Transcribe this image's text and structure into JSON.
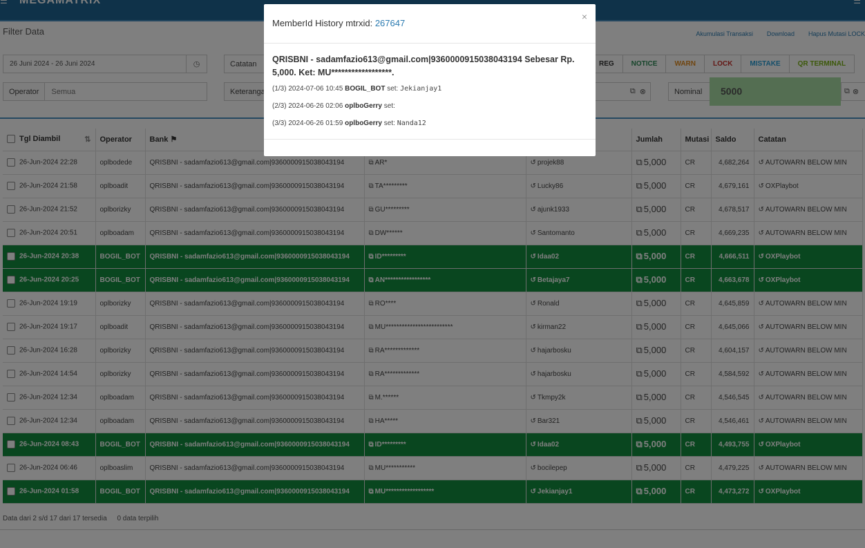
{
  "header": {
    "brand": "MEGAMATRIX"
  },
  "filter": {
    "title": "Filter Data",
    "links": [
      "Akumulasi Transaksi",
      "Download",
      "Hapus Mutasi LOCK"
    ],
    "date_range": "26 Juni 2024 - 26 Juni 2024",
    "catatan_label": "Catatan",
    "operator_label": "Operator",
    "operator_placeholder": "Semua",
    "keterangan_label": "Keterangan",
    "nominal_label": "Nominal",
    "nominal_value": "5000",
    "tags": [
      {
        "label": "REG",
        "color": "#555555"
      },
      {
        "label": "NOTICE",
        "color": "#2e8b57"
      },
      {
        "label": "WARN",
        "color": "#e08a1e"
      },
      {
        "label": "LOCK",
        "color": "#c9302c"
      },
      {
        "label": "MISTAKE",
        "color": "#2a9fd6"
      },
      {
        "label": "QR TERMINAL",
        "color": "#7ab317"
      }
    ]
  },
  "table": {
    "columns": [
      "Tgl Diambil",
      "Operator",
      "Bank",
      "",
      "",
      "Jumlah",
      "Mutasi",
      "Saldo",
      "Catatan"
    ],
    "rows": [
      {
        "tgl": "26-Jun-2024 22:28",
        "operator": "oplbodede",
        "bank": "QRISBNI - sadamfazio613@gmail.com|9360000915038043194",
        "ket": "AR*",
        "member": "projek88",
        "jumlah": "5,000",
        "mutasi": "CR",
        "saldo": "4,682,264",
        "catatan": "AUTOWARN BELOW MIN",
        "hl": false
      },
      {
        "tgl": "26-Jun-2024 21:58",
        "operator": "oplboadit",
        "bank": "QRISBNI - sadamfazio613@gmail.com|9360000915038043194",
        "ket": "TA*********",
        "member": "Lucky86",
        "jumlah": "5,000",
        "mutasi": "CR",
        "saldo": "4,679,161",
        "catatan": "OXPlaybot",
        "hl": false
      },
      {
        "tgl": "26-Jun-2024 21:52",
        "operator": "oplborizky",
        "bank": "QRISBNI - sadamfazio613@gmail.com|9360000915038043194",
        "ket": "GU*********",
        "member": "ajunk1933",
        "jumlah": "5,000",
        "mutasi": "CR",
        "saldo": "4,678,517",
        "catatan": "AUTOWARN BELOW MIN",
        "hl": false
      },
      {
        "tgl": "26-Jun-2024 20:51",
        "operator": "oplboadam",
        "bank": "QRISBNI - sadamfazio613@gmail.com|9360000915038043194",
        "ket": "DW******",
        "member": "Santomanto",
        "jumlah": "5,000",
        "mutasi": "CR",
        "saldo": "4,669,235",
        "catatan": "AUTOWARN BELOW MIN",
        "hl": false
      },
      {
        "tgl": "26-Jun-2024 20:38",
        "operator": "BOGIL_BOT",
        "bank": "QRISBNI - sadamfazio613@gmail.com|9360000915038043194",
        "ket": "ID*********",
        "member": "Idaa02",
        "jumlah": "5,000",
        "mutasi": "CR",
        "saldo": "4,666,511",
        "catatan": "OXPlaybot",
        "hl": true
      },
      {
        "tgl": "26-Jun-2024 20:25",
        "operator": "BOGIL_BOT",
        "bank": "QRISBNI - sadamfazio613@gmail.com|9360000915038043194",
        "ket": "AN*****************",
        "member": "Betajaya7",
        "jumlah": "5,000",
        "mutasi": "CR",
        "saldo": "4,663,678",
        "catatan": "OXPlaybot",
        "hl": true
      },
      {
        "tgl": "26-Jun-2024 19:19",
        "operator": "oplborizky",
        "bank": "QRISBNI - sadamfazio613@gmail.com|9360000915038043194",
        "ket": "RO****",
        "member": "Ronald",
        "jumlah": "5,000",
        "mutasi": "CR",
        "saldo": "4,645,859",
        "catatan": "AUTOWARN BELOW MIN",
        "hl": false
      },
      {
        "tgl": "26-Jun-2024 19:17",
        "operator": "oplboadit",
        "bank": "QRISBNI - sadamfazio613@gmail.com|9360000915038043194",
        "ket": "MU*************************",
        "member": "kirman22",
        "jumlah": "5,000",
        "mutasi": "CR",
        "saldo": "4,645,066",
        "catatan": "AUTOWARN BELOW MIN",
        "hl": false
      },
      {
        "tgl": "26-Jun-2024 16:28",
        "operator": "oplborizky",
        "bank": "QRISBNI - sadamfazio613@gmail.com|9360000915038043194",
        "ket": "RA*************",
        "member": "hajarbosku",
        "jumlah": "5,000",
        "mutasi": "CR",
        "saldo": "4,604,157",
        "catatan": "AUTOWARN BELOW MIN",
        "hl": false
      },
      {
        "tgl": "26-Jun-2024 14:54",
        "operator": "oplborizky",
        "bank": "QRISBNI - sadamfazio613@gmail.com|9360000915038043194",
        "ket": "RA*************",
        "member": "hajarbosku",
        "jumlah": "5,000",
        "mutasi": "CR",
        "saldo": "4,584,592",
        "catatan": "AUTOWARN BELOW MIN",
        "hl": false
      },
      {
        "tgl": "26-Jun-2024 12:34",
        "operator": "oplboadam",
        "bank": "QRISBNI - sadamfazio613@gmail.com|9360000915038043194",
        "ket": "M.******",
        "member": "Tkmpy2k",
        "jumlah": "5,000",
        "mutasi": "CR",
        "saldo": "4,546,545",
        "catatan": "AUTOWARN BELOW MIN",
        "hl": false
      },
      {
        "tgl": "26-Jun-2024 12:34",
        "operator": "oplboadam",
        "bank": "QRISBNI - sadamfazio613@gmail.com|9360000915038043194",
        "ket": "HA*****",
        "member": "Bar321",
        "jumlah": "5,000",
        "mutasi": "CR",
        "saldo": "4,546,461",
        "catatan": "AUTOWARN BELOW MIN",
        "hl": false
      },
      {
        "tgl": "26-Jun-2024 08:43",
        "operator": "BOGIL_BOT",
        "bank": "QRISBNI - sadamfazio613@gmail.com|9360000915038043194",
        "ket": "ID*********",
        "member": "Idaa02",
        "jumlah": "5,000",
        "mutasi": "CR",
        "saldo": "4,493,755",
        "catatan": "OXPlaybot",
        "hl": true
      },
      {
        "tgl": "26-Jun-2024 06:46",
        "operator": "oplboaslim",
        "bank": "QRISBNI - sadamfazio613@gmail.com|9360000915038043194",
        "ket": "MU***********",
        "member": "bocilepep",
        "jumlah": "5,000",
        "mutasi": "CR",
        "saldo": "4,479,225",
        "catatan": "AUTOWARN BELOW MIN",
        "hl": false
      },
      {
        "tgl": "26-Jun-2024 01:58",
        "operator": "BOGIL_BOT",
        "bank": "QRISBNI - sadamfazio613@gmail.com|9360000915038043194",
        "ket": "MU******************",
        "member": "Jekianjay1",
        "jumlah": "5,000",
        "mutasi": "CR",
        "saldo": "4,473,272",
        "catatan": "OXPlaybot",
        "hl": true
      }
    ]
  },
  "footer": {
    "info": "Data dari 2 s/d 17 dari 17 tersedia",
    "selected": "0 data terpilih"
  },
  "modal": {
    "title_prefix": "MemberId History mtrxid: ",
    "mtrxid": "267647",
    "message": "QRISBNI - sadamfazio613@gmail.com|9360000915038043194 Sebesar Rp. 5,000. Ket: MU******************.",
    "history": [
      {
        "idx": "(1/3)",
        "time": "2024-07-06 10:45",
        "user": "BOGIL_BOT",
        "set": "set:",
        "value": "Jekianjay1"
      },
      {
        "idx": "(2/3)",
        "time": "2024-06-26 02:06",
        "user": "oplboGerry",
        "set": "set:",
        "value": ""
      },
      {
        "idx": "(3/3)",
        "time": "2024-06-26 01:59",
        "user": "oplboGerry",
        "set": "set:",
        "value": "Nanda12"
      }
    ]
  }
}
